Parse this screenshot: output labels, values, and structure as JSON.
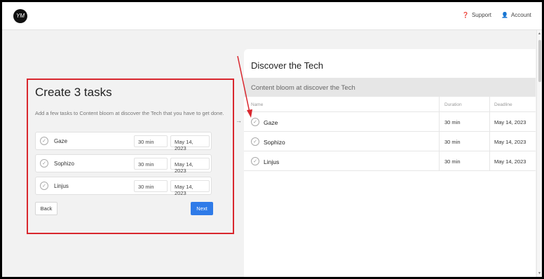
{
  "header": {
    "logo_text": "YM",
    "support_label": "Support",
    "account_label": "Account",
    "support_icon": "help-circle-icon",
    "account_icon": "user-icon"
  },
  "left_card": {
    "title": "Create 3 tasks",
    "description": "Add a few tasks to Content bloom at discover the Tech that you have to get done.",
    "tasks": [
      {
        "name": "Gaze",
        "duration": "30 min",
        "deadline": "May 14, 2023"
      },
      {
        "name": "Sophizo",
        "duration": "30 min",
        "deadline": "May 14, 2023"
      },
      {
        "name": "Linjus",
        "duration": "30 min",
        "deadline": "May 14, 2023"
      }
    ],
    "back_label": "Back",
    "next_label": "Next"
  },
  "right_panel": {
    "title": "Discover the Tech",
    "section": "Content bloom at discover the Tech",
    "columns": [
      "Name",
      "Duration",
      "Deadline"
    ],
    "rows": [
      {
        "name": "Gaze",
        "duration": "30 min",
        "deadline": "May 14, 2023"
      },
      {
        "name": "Sophizo",
        "duration": "30 min",
        "deadline": "May 14, 2023"
      },
      {
        "name": "Linjus",
        "duration": "30 min",
        "deadline": "May 14, 2023"
      }
    ]
  },
  "colors": {
    "accent": "#2f7be8",
    "annotation_red": "#d9272e"
  }
}
